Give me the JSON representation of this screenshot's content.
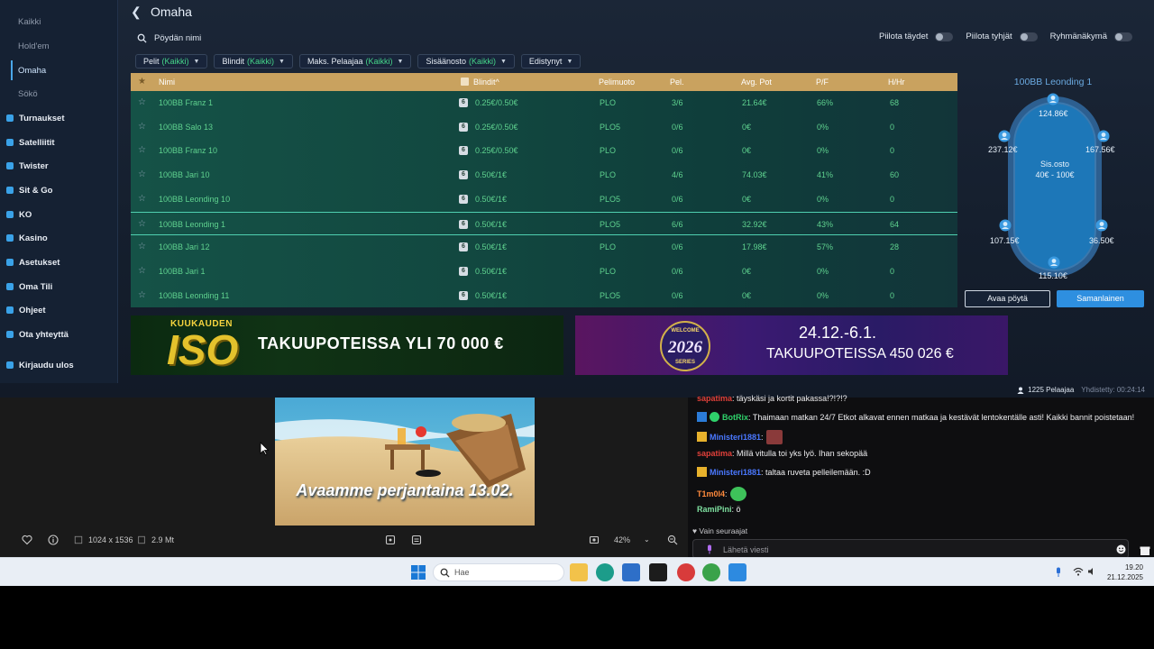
{
  "sidebar": {
    "items": [
      {
        "label": "Kaikki",
        "sub": true
      },
      {
        "label": "Hold'em",
        "sub": true
      },
      {
        "label": "Omaha",
        "sub": true,
        "active": true
      },
      {
        "label": "Sökö",
        "sub": true
      },
      {
        "label": "Turnaukset"
      },
      {
        "label": "Satelliitit"
      },
      {
        "label": "Twister"
      },
      {
        "label": "Sit & Go"
      },
      {
        "label": "KO"
      },
      {
        "label": "Kasino"
      },
      {
        "label": "Asetukset"
      },
      {
        "label": "Oma Tili"
      },
      {
        "label": "Ohjeet"
      },
      {
        "label": "Ota yhteyttä"
      },
      {
        "label": "Kirjaudu ulos"
      }
    ]
  },
  "header": {
    "title": "Omaha",
    "search_placeholder": "Pöydän nimi"
  },
  "toggles": [
    {
      "label": "Piilota täydet"
    },
    {
      "label": "Piilota tyhjät"
    },
    {
      "label": "Ryhmänäkymä"
    }
  ],
  "filters": [
    {
      "label": "Pelit",
      "value": "(Kaikki)"
    },
    {
      "label": "Blindit",
      "value": "(Kaikki)"
    },
    {
      "label": "Maks. Pelaajaa",
      "value": "(Kaikki)"
    },
    {
      "label": "Sisäänosto",
      "value": "(Kaikki)"
    },
    {
      "label": "Edistynyt",
      "value": ""
    }
  ],
  "table": {
    "columns": [
      "Nimi",
      "Blindit^",
      "Pelimuoto",
      "Pel.",
      "Avg. Pot",
      "P/F",
      "H/Hr"
    ],
    "badge": "6",
    "rows": [
      {
        "name": "100BB Franz 1",
        "blinds": "0.25€/0.50€",
        "mode": "PLO",
        "players": "3/6",
        "avg": "21.64€",
        "pf": "66%",
        "hhr": "68"
      },
      {
        "name": "100BB Salo 13",
        "blinds": "0.25€/0.50€",
        "mode": "PLO5",
        "players": "0/6",
        "avg": "0€",
        "pf": "0%",
        "hhr": "0"
      },
      {
        "name": "100BB Franz 10",
        "blinds": "0.25€/0.50€",
        "mode": "PLO",
        "players": "0/6",
        "avg": "0€",
        "pf": "0%",
        "hhr": "0"
      },
      {
        "name": "100BB Jari 10",
        "blinds": "0.50€/1€",
        "mode": "PLO",
        "players": "4/6",
        "avg": "74.03€",
        "pf": "41%",
        "hhr": "60"
      },
      {
        "name": "100BB Leonding 10",
        "blinds": "0.50€/1€",
        "mode": "PLO5",
        "players": "0/6",
        "avg": "0€",
        "pf": "0%",
        "hhr": "0"
      },
      {
        "name": "100BB Leonding 1",
        "blinds": "0.50€/1€",
        "mode": "PLO5",
        "players": "6/6",
        "avg": "32.92€",
        "pf": "43%",
        "hhr": "64",
        "selected": true
      },
      {
        "name": "100BB Jari 12",
        "blinds": "0.50€/1€",
        "mode": "PLO",
        "players": "0/6",
        "avg": "17.98€",
        "pf": "57%",
        "hhr": "28"
      },
      {
        "name": "100BB Jari 1",
        "blinds": "0.50€/1€",
        "mode": "PLO",
        "players": "0/6",
        "avg": "0€",
        "pf": "0%",
        "hhr": "0"
      },
      {
        "name": "100BB Leonding 11",
        "blinds": "0.50€/1€",
        "mode": "PLO5",
        "players": "0/6",
        "avg": "0€",
        "pf": "0%",
        "hhr": "0"
      }
    ]
  },
  "preview": {
    "title": "100BB Leonding 1",
    "center_line1": "Sis.osto",
    "center_line2": "40€ - 100€",
    "seats": [
      "124.86€",
      "167.56€",
      "36.50€",
      "115.10€",
      "107.15€",
      "237.12€"
    ],
    "open_button": "Avaa pöytä",
    "similar_button": "Samanlainen"
  },
  "banners": {
    "left_kicker": "KUUKAUDEN",
    "left_logo": "ISO",
    "left_claim": "TAKUUPOTEISSA YLI 70 000 €",
    "right_logo_top": "WELCOME",
    "right_logo_year": "2026",
    "right_logo_bottom": "SERIES",
    "right_dates": "24.12.-6.1.",
    "right_claim": "TAKUUPOTEISSA 450 026 €"
  },
  "status": {
    "players": "1225 Pelaajaa",
    "connected": "Yhdistetty: 00:24:14"
  },
  "viewer": {
    "caption": "Avaamme perjantaina 13.02.",
    "dimensions": "1024 x 1536",
    "size": "2.9 Mt",
    "zoom": "42%"
  },
  "chat": {
    "messages": [
      {
        "nick": "sapatima",
        "color": "#e0403a",
        "text": ": täyskäsi ja kortit pakassa!?!?!?"
      },
      {
        "nick": "BotRix",
        "color": "#2fd26b",
        "text": ": Thaimaan matkan 24/7 Etkot alkavat ennen matkaa ja kestävät lentokentälle asti! Kaikki bannit poistetaan!"
      },
      {
        "nick": "Ministeri1881",
        "color": "#4a78ff",
        "text": ":"
      },
      {
        "nick": "sapatima",
        "color": "#e0403a",
        "text": ": Millä vitulla toi yks lyö. Ihan sekopää"
      },
      {
        "nick": "Ministeri1881",
        "color": "#4a78ff",
        "text": ": taltaa ruveta pelleilemään. :D"
      },
      {
        "nick": "T1m0l4",
        "color": "#ff8a3c",
        "text": ":"
      },
      {
        "nick": "RamiPini",
        "color": "#7ee0a0",
        "text": ": ö"
      }
    ],
    "follow_note": "Vain seuraajat",
    "input_placeholder": "Lähetä viesti"
  },
  "taskbar": {
    "search": "Hae",
    "time": "19.20",
    "date": "21.12.2025"
  }
}
